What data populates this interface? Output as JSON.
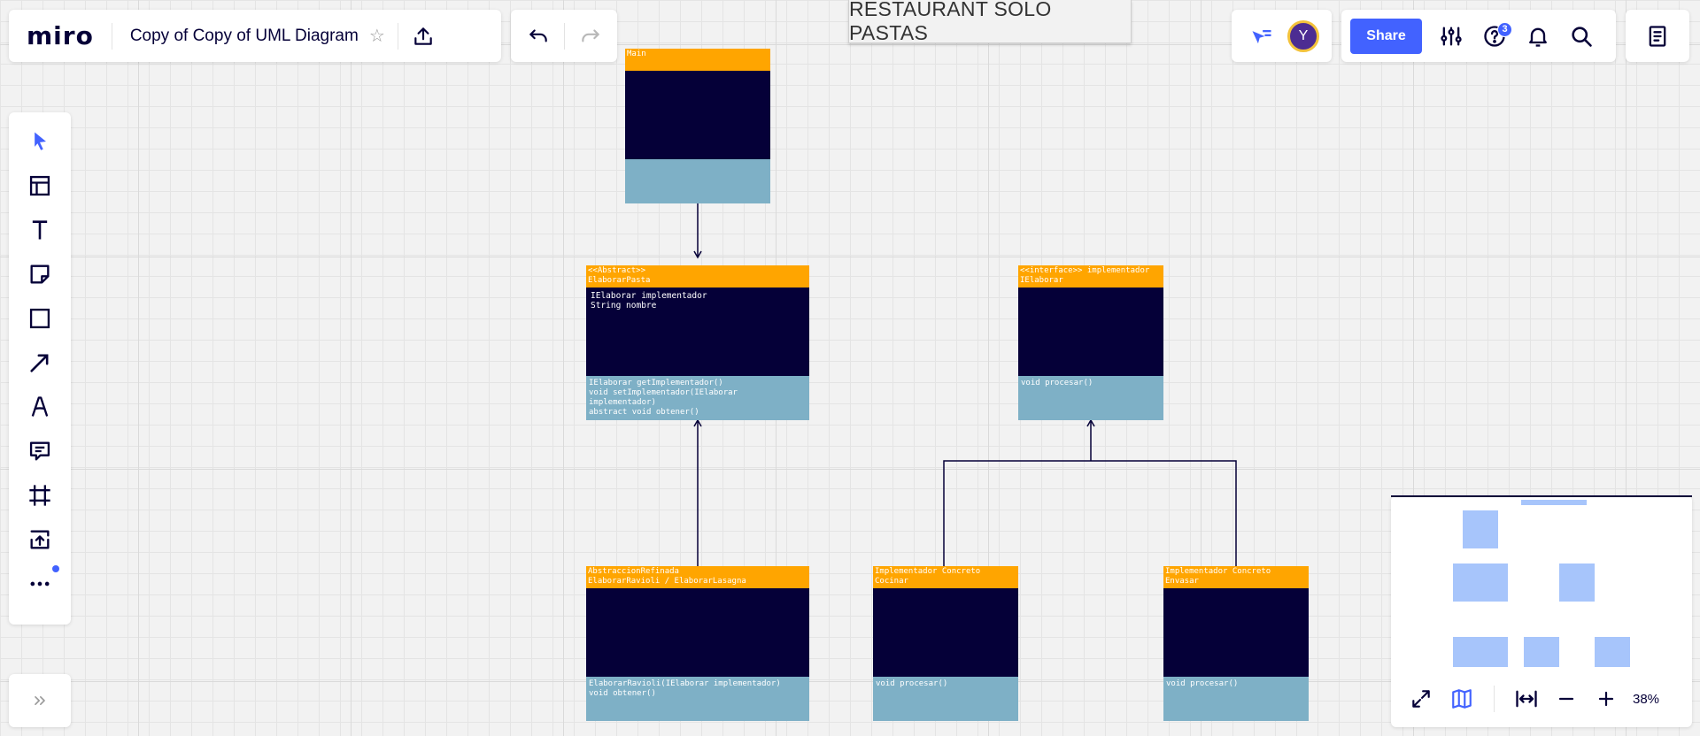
{
  "app": {
    "logo": "miro"
  },
  "board": {
    "title": "Copy of Copy of UML Diagram"
  },
  "user": {
    "avatar_initial": "Y"
  },
  "header": {
    "share_label": "Share",
    "help_badge": "3"
  },
  "canvas": {
    "title_text": "RESTAURANT SOLO PASTAS"
  },
  "zoom": {
    "level": "38%"
  },
  "uml": {
    "main": {
      "header": "Main",
      "attributes": "",
      "methods": ""
    },
    "abstract": {
      "header": "<<Abstract>>\nElaborarPasta",
      "attributes": "IElaborar implementador\nString nombre",
      "methods": "IElaborar getImplementador()\nvoid setImplementador(IElaborar implementador)\nabstract void obtener()"
    },
    "interface": {
      "header": "<<interface>> implementador\nIElaborar",
      "attributes": "",
      "methods": "void procesar()"
    },
    "refined": {
      "header": "AbstraccionRefinada\nElaborarRavioli / ElaborarLasagna",
      "attributes": "",
      "methods": "ElaborarRavioli(IElaborar implementador)\nvoid obtener()"
    },
    "cocinar": {
      "header": "Implementador Concreto\nCocinar",
      "attributes": "",
      "methods": "void procesar()"
    },
    "envasar": {
      "header": "Implementador Concreto\nEnvasar",
      "attributes": "",
      "methods": "void procesar()"
    }
  },
  "colors": {
    "accent": "#4262ff",
    "uml_header": "#ffa500",
    "uml_body": "#050038",
    "uml_methods": "#7eb0c6"
  },
  "icons": {
    "toolbar": [
      "select-icon",
      "templates-icon",
      "text-icon",
      "sticky-note-icon",
      "shape-icon",
      "arrow-icon",
      "pen-icon",
      "comment-icon",
      "frame-icon",
      "upload-icon",
      "more-icon"
    ]
  }
}
